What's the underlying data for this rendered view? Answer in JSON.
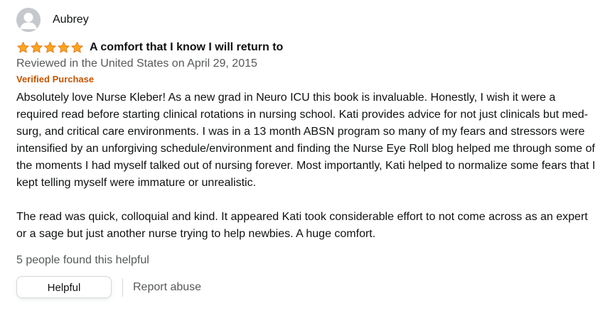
{
  "reviewer": {
    "name": "Aubrey"
  },
  "rating": {
    "stars": 5,
    "max": 5,
    "color": "#ffa41c"
  },
  "review": {
    "title": "A comfort that I know I will return to",
    "date_line": "Reviewed in the United States on April 29, 2015",
    "verified_label": "Verified Purchase",
    "paragraphs": [
      "Absolutely love Nurse Kleber! As a new grad in Neuro ICU this book is invaluable. Honestly, I wish it were a required read before starting clinical rotations in nursing school. Kati provides advice for not just clinicals but med-surg, and critical care environments. I was in a 13 month ABSN program so many of my fears and stressors were intensified by an unforgiving schedule/environment and finding the Nurse Eye Roll blog helped me through some of the moments I had myself talked out of nursing forever. Most importantly, Kati helped to normalize some fears that I kept telling myself were immature or unrealistic.",
      "The read was quick, colloquial and kind. It appeared Kati took considerable effort to not come across as an expert or a sage but just another nurse trying to help newbies. A huge comfort."
    ],
    "helpful_count_text": "5 people found this helpful"
  },
  "actions": {
    "helpful_label": "Helpful",
    "report_label": "Report abuse"
  },
  "colors": {
    "verified": "#c45500",
    "muted_text": "#565959",
    "body_text": "#0f1111",
    "avatar_bg": "#c5c8cc"
  },
  "icons": {
    "avatar": "default-user-avatar-icon",
    "star": "star-filled-icon"
  }
}
